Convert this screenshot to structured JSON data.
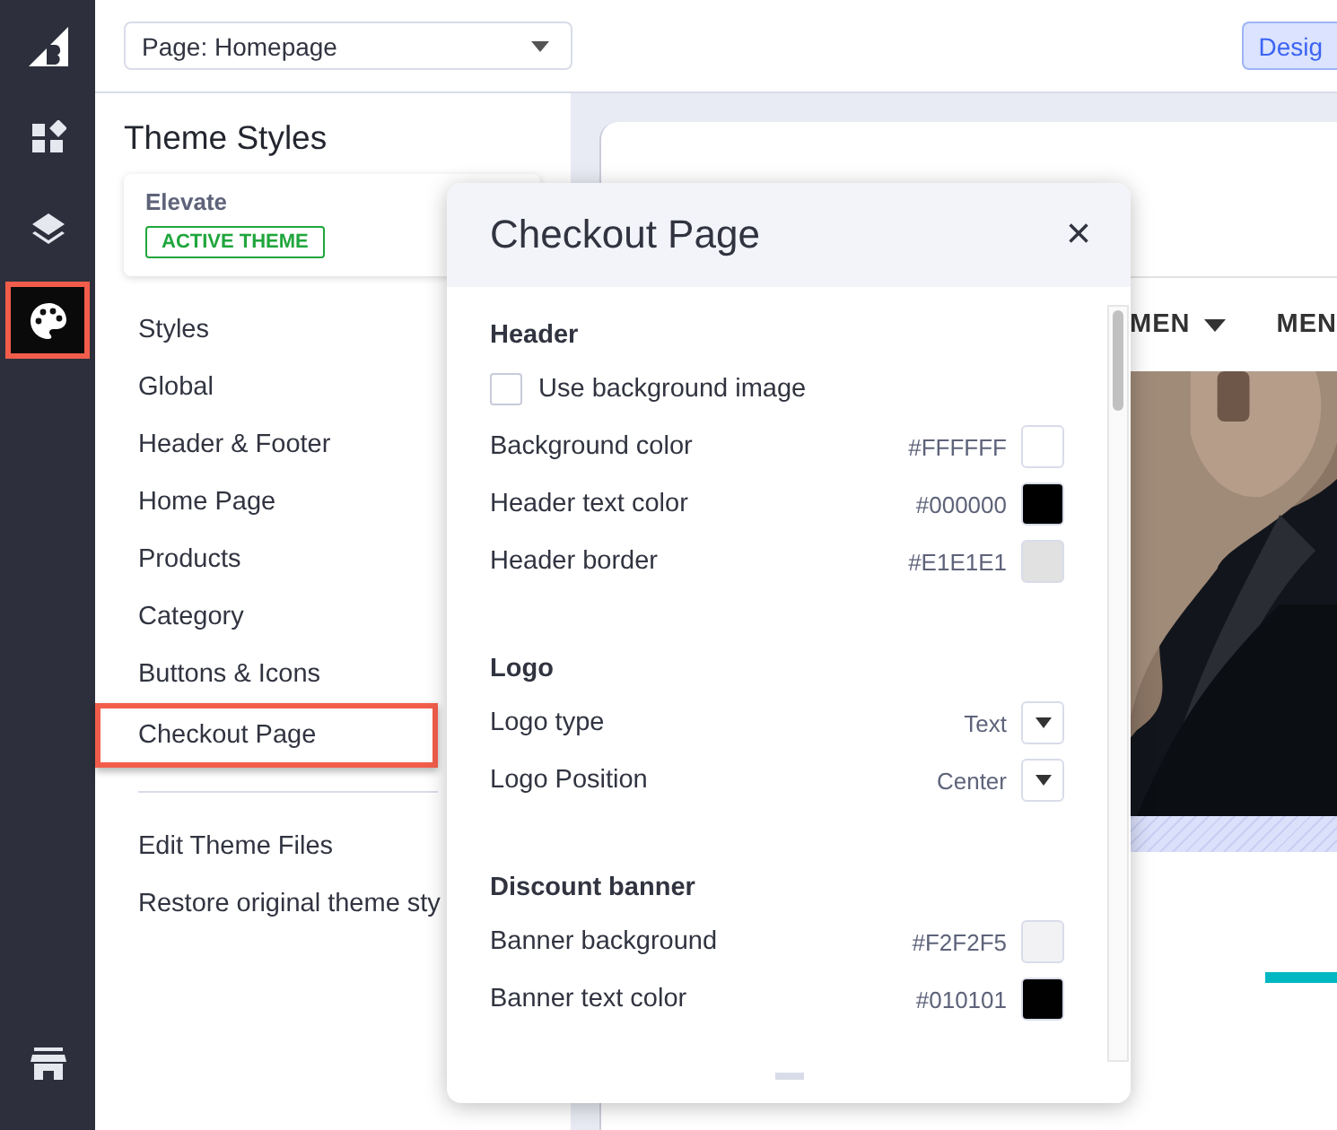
{
  "rail": [
    {
      "kind": "logo",
      "selected": false
    },
    {
      "kind": "widgets",
      "selected": false
    },
    {
      "kind": "layers",
      "selected": false
    },
    {
      "kind": "palette",
      "selected": true
    },
    {
      "kind": "store",
      "selected": false
    }
  ],
  "topbar": {
    "page_select": "Page: Homepage",
    "mode_button": "Desig"
  },
  "theme_panel": {
    "title": "Theme Styles",
    "theme_name": "Elevate",
    "theme_badge": "ACTIVE THEME",
    "items": [
      {
        "label": "Styles",
        "selected": false
      },
      {
        "label": "Global",
        "selected": false
      },
      {
        "label": "Header & Footer",
        "selected": false
      },
      {
        "label": "Home Page",
        "selected": false
      },
      {
        "label": "Products",
        "selected": false
      },
      {
        "label": "Category",
        "selected": false
      },
      {
        "label": "Buttons & Icons",
        "selected": false
      },
      {
        "label": "Checkout Page",
        "selected": true
      }
    ],
    "links": [
      "Edit Theme Files",
      "Restore original theme sty"
    ]
  },
  "preview": {
    "nav": [
      {
        "label": "MEN",
        "dropdown": true
      },
      {
        "label": "MEN",
        "dropdown": false
      }
    ]
  },
  "modal": {
    "title": "Checkout Page",
    "close": "×",
    "sections": [
      {
        "heading": "Header",
        "rows": [
          {
            "kind": "checkbox",
            "label": "Use background image",
            "checked": false
          },
          {
            "kind": "color",
            "label": "Background color",
            "value": "#FFFFFF"
          },
          {
            "kind": "color",
            "label": "Header text color",
            "value": "#000000"
          },
          {
            "kind": "color",
            "label": "Header border",
            "value": "#E1E1E1"
          }
        ]
      },
      {
        "heading": "Logo",
        "rows": [
          {
            "kind": "select",
            "label": "Logo type",
            "value": "Text"
          },
          {
            "kind": "select",
            "label": "Logo Position",
            "value": "Center"
          }
        ]
      },
      {
        "heading": "Discount banner",
        "rows": [
          {
            "kind": "color",
            "label": "Banner background",
            "value": "#F2F2F5"
          },
          {
            "kind": "color",
            "label": "Banner text color",
            "value": "#010101"
          }
        ]
      }
    ]
  }
}
